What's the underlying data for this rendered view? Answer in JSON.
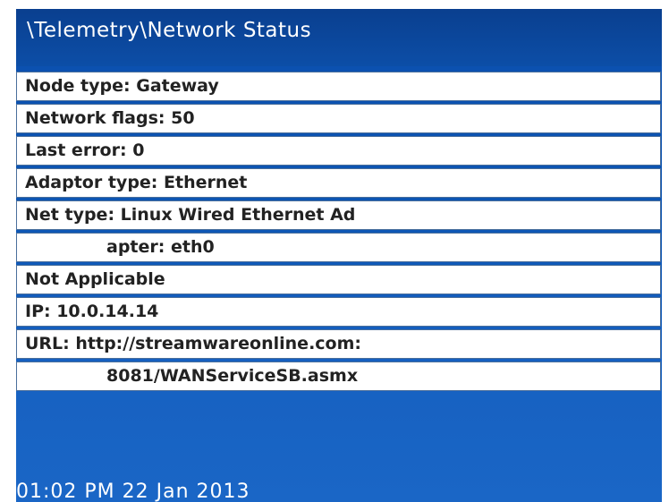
{
  "header": {
    "title": "\\Telemetry\\Network Status"
  },
  "rows": [
    {
      "text": "Node type: Gateway"
    },
    {
      "text": "Network flags: 50"
    },
    {
      "text": "Last error: 0"
    },
    {
      "text": "Adaptor type: Ethernet"
    },
    {
      "text": "Net type: Linux Wired Ethernet Ad"
    },
    {
      "text": "apter: eth0"
    },
    {
      "text": "Not Applicable"
    },
    {
      "text": "IP: 10.0.14.14"
    },
    {
      "text": "URL: http://streamwareonline.com:"
    },
    {
      "text": "8081/WANServiceSB.asmx"
    }
  ],
  "footer": {
    "datetime": "01:02 PM 22 Jan 2013"
  }
}
